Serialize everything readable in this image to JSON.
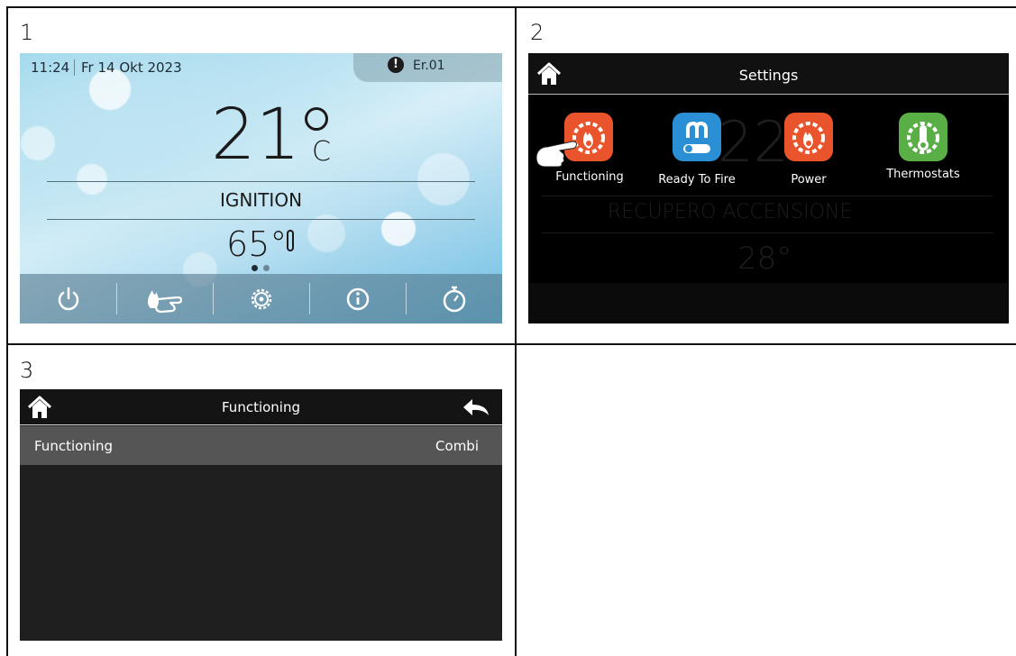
{
  "steps": [
    "1",
    "2",
    "3"
  ],
  "panel1": {
    "time": "11:24",
    "date": "Fr 14 Okt 2023",
    "error_code": "Er.01",
    "room_temp": "21",
    "unit": "C",
    "status": "IGNITION",
    "water_temp": "65°",
    "page_indicator": {
      "pages": 2,
      "active": 1
    },
    "bottom_bar": [
      "power-icon",
      "fire-hand-icon",
      "gear-icon",
      "info-icon",
      "timer-icon"
    ],
    "bg_color": "#8fd2ea"
  },
  "panel2": {
    "title": "Settings",
    "apps": [
      {
        "label": "Functioning",
        "color": "#e9542c",
        "icon": "fire-gear-icon"
      },
      {
        "label": "Ready To Fire",
        "color": "#2a8fd4",
        "icon": "ready-to-fire-icon"
      },
      {
        "label": "Power",
        "color": "#e9542c",
        "icon": "fire-gear-icon"
      },
      {
        "label": "Thermostats",
        "color": "#5aae46",
        "icon": "thermometer-gear-icon"
      }
    ],
    "background_temp": "22",
    "background_status": "RECUPERO ACCENSIONE",
    "background_water": "28°"
  },
  "panel3": {
    "title": "Functioning",
    "row_label": "Functioning",
    "row_value": "Combi"
  }
}
